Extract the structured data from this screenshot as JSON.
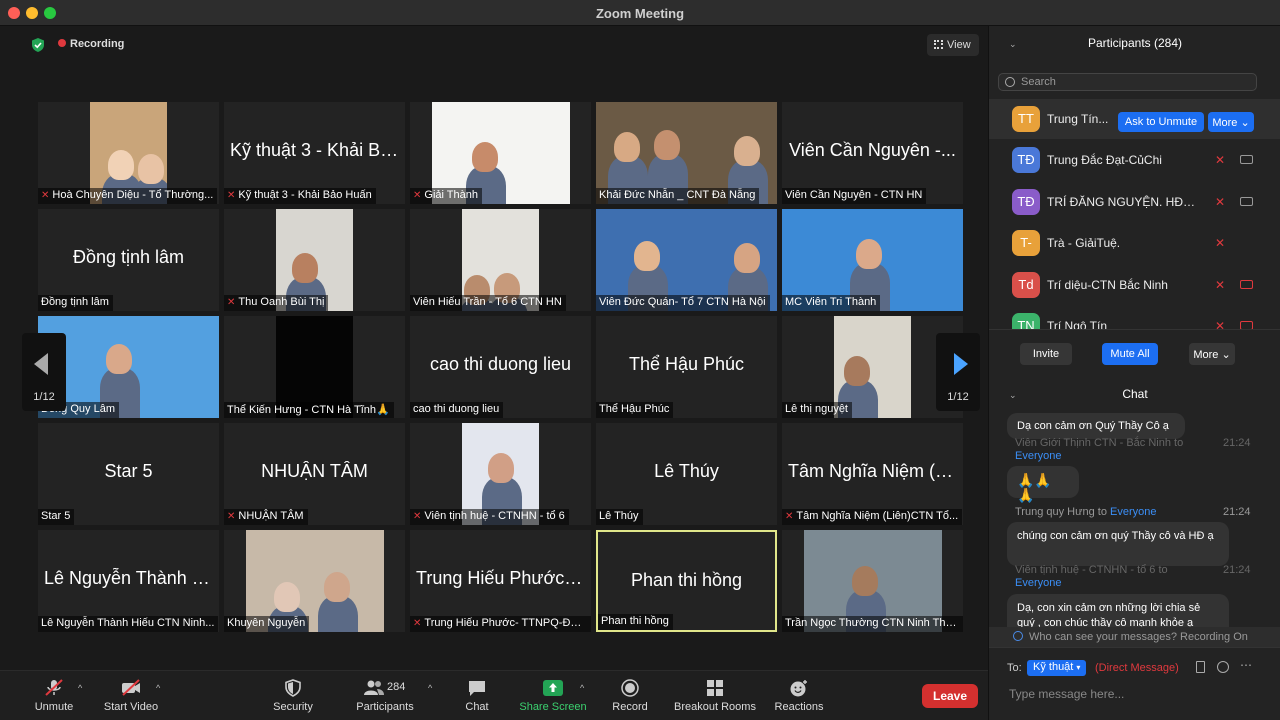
{
  "window": {
    "title": "Zoom Meeting"
  },
  "meeting": {
    "recording_label": "Recording",
    "view_label": "View",
    "page_left": "1/12",
    "page_right": "1/12"
  },
  "tiles": [
    {
      "name": "Hoà Chuyên Diệu - Tổ Thường...",
      "big": "",
      "muted": true
    },
    {
      "name": "Kỹ thuật 3 - Khải Bảo Huấn",
      "big": "Kỹ thuật 3 - Khải Bả...",
      "muted": true
    },
    {
      "name": "Giải Thành",
      "big": "",
      "muted": true
    },
    {
      "name": "Khải Đức Nhẫn _ CNT Đà Nẵng",
      "big": "",
      "muted": false
    },
    {
      "name": "Viên Cần Nguyên - CTN HN",
      "big": "Viên Cần Nguyên -...",
      "muted": false
    },
    {
      "name": "Đồng tịnh lâm",
      "big": "Đồng tịnh lâm",
      "muted": false
    },
    {
      "name": "Thu Oanh Bùi Thị",
      "big": "",
      "muted": true
    },
    {
      "name": "Viên Hiếu Trần - Tổ 6 CTN HN",
      "big": "",
      "muted": false
    },
    {
      "name": "Viên Đức Quán- Tổ 7 CTN Hà Nội",
      "big": "",
      "muted": false
    },
    {
      "name": "MC Viên Tri Thành",
      "big": "",
      "muted": false
    },
    {
      "name": "Đồng Quy Lâm",
      "big": "",
      "muted": false
    },
    {
      "name": "Thể Kiến Hưng - CTN Hà Tĩnh🙏",
      "big": "",
      "muted": false
    },
    {
      "name": "cao thi duong lieu",
      "big": "cao thi duong lieu",
      "muted": false
    },
    {
      "name": "Thể Hậu Phúc",
      "big": "Thể Hậu Phúc",
      "muted": false
    },
    {
      "name": "Lê thị nguyệt",
      "big": "",
      "muted": false
    },
    {
      "name": "Star 5",
      "big": "Star 5",
      "muted": false
    },
    {
      "name": "NHUẬN TÂM",
      "big": "NHUẬN TÂM",
      "muted": true
    },
    {
      "name": "Viên tịnh huệ - CTNHN - tổ 6",
      "big": "",
      "muted": true
    },
    {
      "name": "Lê Thúy",
      "big": "Lê Thúy",
      "muted": false
    },
    {
      "name": "Tâm Nghĩa Niệm (Liên)CTN Tổ...",
      "big": "Tâm Nghĩa Niệm (Li...",
      "muted": true
    },
    {
      "name": "Lê Nguyễn Thành Hiếu CTN Ninh...",
      "big": "Lê Nguyễn Thành H...",
      "muted": false
    },
    {
      "name": "Khuyên Nguyễn",
      "big": "",
      "muted": false
    },
    {
      "name": "Trung Hiếu Phước- TTNPQ-ĐỨ...",
      "big": "Trung Hiếu Phước-...",
      "muted": true
    },
    {
      "name": "Phan thi  hồng",
      "big": "Phan thi  hồng",
      "muted": false
    },
    {
      "name": "Trần Ngọc Thường CTN Ninh Thu...",
      "big": "",
      "muted": false
    }
  ],
  "toolbar": {
    "unmute": "Unmute",
    "start_video": "Start Video",
    "security": "Security",
    "participants": "Participants",
    "participants_count": "284",
    "chat": "Chat",
    "share_screen": "Share Screen",
    "record": "Record",
    "breakout": "Breakout Rooms",
    "reactions": "Reactions",
    "leave": "Leave"
  },
  "participants": {
    "header": "Participants (284)",
    "search_placeholder": "Search",
    "ask_to_unmute": "Ask to Unmute",
    "more": "More",
    "rows": [
      {
        "initials": "TT",
        "name": "Trung Tín...",
        "color": "#e8a13a"
      },
      {
        "initials": "TĐ",
        "name": "Trung Đắc Đạt-CủChi",
        "color": "#4a78d8"
      },
      {
        "initials": "TĐ",
        "name": "TRÍ ĐĂNG NGUYỆN. HĐ. KO...",
        "color": "#8a5cc9"
      },
      {
        "initials": "T-",
        "name": "Trà - GiảiTuệ.",
        "color": "#e8a13a"
      },
      {
        "initials": "Td",
        "name": "Trí diệu-CTN Bắc Ninh",
        "color": "#d9504a"
      },
      {
        "initials": "TN",
        "name": "Trí Ngộ Tín",
        "color": "#3bb36a"
      }
    ],
    "invite": "Invite",
    "mute_all": "Mute All",
    "more_bottom": "More"
  },
  "chat": {
    "header": "Chat",
    "msg1": "Dạ con cảm ơn Quý Thầy Cô ạ",
    "meta2_sender": "Viên Giới Thịnh CTN - Bắc Ninh to",
    "meta2_to": "Everyone",
    "time2": "21:24",
    "msg2": "🙏🙏🙏",
    "meta3_sender": "Trung quy Hưng to",
    "meta3_to": "Everyone",
    "time3": "21:24",
    "msg3": "chúng con cảm ơn quý Thầy cô và HĐ ạ",
    "meta4_sender": "Viên tịnh huệ - CTNHN - tổ 6 to",
    "meta4_to": "Everyone",
    "time4": "21:24",
    "msg4": "Dạ, con xin cảm ơn những lời chia sẻ quý , con chúc thầy cô mạnh khỏe ạ",
    "who_can_see": "Who can see your messages? Recording On",
    "to_label": "To:",
    "to_value": "Kỹ thuật",
    "direct": "(Direct Message)",
    "input_placeholder": "Type message here..."
  }
}
